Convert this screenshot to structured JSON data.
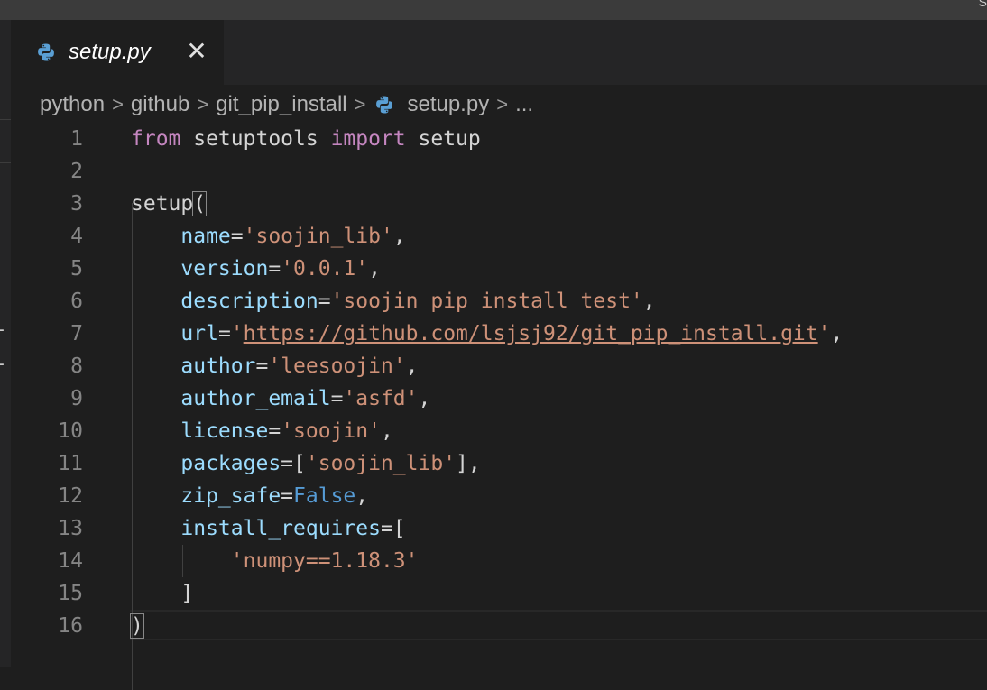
{
  "window": {
    "top_right_char": "S"
  },
  "tab": {
    "label": "setup.py",
    "close_glyph": "✕",
    "icon": "python-icon"
  },
  "breadcrumb": {
    "items": [
      "python",
      "github",
      "git_pip_install",
      "setup.py",
      "..."
    ],
    "separator": ">"
  },
  "side_panel": {
    "dots1": "...",
    "dots2": "..."
  },
  "colors": {
    "background": "#1e1e1e",
    "keyword": "#c586c0",
    "param": "#9cdcfe",
    "string": "#ce9178",
    "boolean": "#569cd6",
    "line_number": "#858585"
  },
  "editor": {
    "line_numbers": [
      "1",
      "2",
      "3",
      "4",
      "5",
      "6",
      "7",
      "8",
      "9",
      "10",
      "11",
      "12",
      "13",
      "14",
      "15",
      "16"
    ],
    "lines": {
      "l1": {
        "kw1": "from",
        "mod": " setuptools ",
        "kw2": "import",
        "name": " setup"
      },
      "l3": {
        "call": "setup",
        "paren": "("
      },
      "l4": {
        "param": "name",
        "eq": "=",
        "val": "'soojin_lib'",
        "comma": ","
      },
      "l5": {
        "param": "version",
        "eq": "=",
        "val": "'0.0.1'",
        "comma": ","
      },
      "l6": {
        "param": "description",
        "eq": "=",
        "val": "'soojin pip install test'",
        "comma": ","
      },
      "l7": {
        "param": "url",
        "eq": "=",
        "q1": "'",
        "url": "https://github.com/lsjsj92/git_pip_install.git",
        "q2": "'",
        "comma": ","
      },
      "l8": {
        "param": "author",
        "eq": "=",
        "val": "'leesoojin'",
        "comma": ","
      },
      "l9": {
        "param": "author_email",
        "eq": "=",
        "val": "'asfd'",
        "comma": ","
      },
      "l10": {
        "param": "license",
        "eq": "=",
        "val": "'soojin'",
        "comma": ","
      },
      "l11": {
        "param": "packages",
        "eq": "=[",
        "val": "'soojin_lib'",
        "close": "],"
      },
      "l12": {
        "param": "zip_safe",
        "eq": "=",
        "val": "False",
        "comma": ","
      },
      "l13": {
        "param": "install_requires",
        "eq": "=["
      },
      "l14": {
        "val": "'numpy==1.18.3'"
      },
      "l15": {
        "close": "]"
      },
      "l16": {
        "paren": ")"
      }
    }
  }
}
